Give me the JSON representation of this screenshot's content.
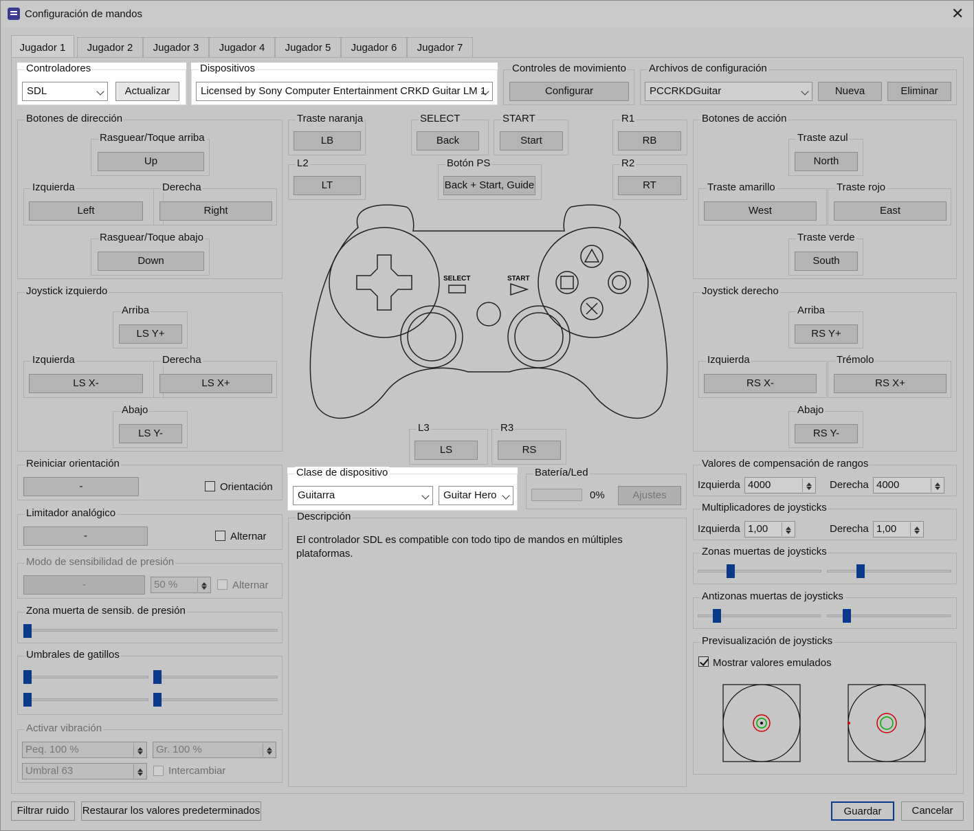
{
  "window": {
    "title": "Configuración de mandos"
  },
  "tabs": [
    "Jugador 1",
    "Jugador 2",
    "Jugador 3",
    "Jugador 4",
    "Jugador 5",
    "Jugador 6",
    "Jugador 7"
  ],
  "controllers": {
    "label": "Controladores",
    "value": "SDL",
    "refresh": "Actualizar"
  },
  "devices": {
    "label": "Dispositivos",
    "value": "Licensed by Sony Computer Entertainment CRKD Guitar LM 1"
  },
  "motion": {
    "label": "Controles de movimiento",
    "button": "Configurar"
  },
  "config_files": {
    "label": "Archivos de configuración",
    "value": "PCCRKDGuitar",
    "new": "Nueva",
    "delete": "Eliminar"
  },
  "dpad": {
    "label": "Botones de dirección",
    "up_label": "Rasguear/Toque arriba",
    "up": "Up",
    "left_label": "Izquierda",
    "left": "Left",
    "right_label": "Derecha",
    "right": "Right",
    "down_label": "Rasguear/Toque abajo",
    "down": "Down"
  },
  "center_buttons": {
    "orange_label": "Traste naranja",
    "orange": "LB",
    "select_label": "SELECT",
    "select": "Back",
    "start_label": "START",
    "start": "Start",
    "r1_label": "R1",
    "r1": "RB",
    "l2_label": "L2",
    "l2": "LT",
    "ps_label": "Botón PS",
    "ps": "Back + Start, Guide",
    "r2_label": "R2",
    "r2": "RT",
    "l3_label": "L3",
    "l3": "LS",
    "r3_label": "R3",
    "r3": "RS",
    "pad_select": "SELECT",
    "pad_start": "START"
  },
  "action": {
    "label": "Botones de acción",
    "blue_label": "Traste azul",
    "blue": "North",
    "yellow_label": "Traste amarillo",
    "yellow": "West",
    "red_label": "Traste rojo",
    "red": "East",
    "green_label": "Traste verde",
    "green": "South"
  },
  "left_stick": {
    "label": "Joystick izquierdo",
    "up_label": "Arriba",
    "up": "LS Y+",
    "left_label": "Izquierda",
    "left": "LS X-",
    "right_label": "Derecha",
    "right": "LS X+",
    "down_label": "Abajo",
    "down": "LS Y-"
  },
  "right_stick": {
    "label": "Joystick derecho",
    "up_label": "Arriba",
    "up": "RS Y+",
    "left_label": "Izquierda",
    "left": "RS X-",
    "right_label": "Trémolo",
    "right": "RS X+",
    "down_label": "Abajo",
    "down": "RS Y-"
  },
  "reset_orientation": {
    "label": "Reiniciar orientación",
    "button": "-",
    "check": "Orientación"
  },
  "analog_limiter": {
    "label": "Limitador analógico",
    "button": "-",
    "check": "Alternar"
  },
  "pressure_mode": {
    "label": "Modo de sensibilidad de presión",
    "button": "-",
    "value": "50 %",
    "check": "Alternar"
  },
  "pressure_deadzone": {
    "label": "Zona muerta de sensib. de presión"
  },
  "trigger_thresholds": {
    "label": "Umbrales de gatillos"
  },
  "vibration": {
    "label": "Activar vibración",
    "small": "Peq. 100 %",
    "large": "Gr. 100 %",
    "threshold": "Umbral 63",
    "swap": "Intercambiar"
  },
  "device_class": {
    "label": "Clase de dispositivo",
    "value": "Guitarra",
    "type": "Guitar Hero"
  },
  "battery": {
    "label": "Batería/Led",
    "percent": "0%",
    "settings": "Ajustes"
  },
  "description": {
    "label": "Descripción",
    "text": "El controlador SDL es compatible con todo tipo de mandos en múltiples plataformas."
  },
  "range_comp": {
    "label": "Valores de compensación de rangos",
    "left_label": "Izquierda",
    "left": "4000",
    "right_label": "Derecha",
    "right": "4000"
  },
  "multipliers": {
    "label": "Multiplicadores de joysticks",
    "left_label": "Izquierda",
    "left": "1,00",
    "right_label": "Derecha",
    "right": "1,00"
  },
  "deadzones": {
    "label": "Zonas muertas de joysticks"
  },
  "antideadzones": {
    "label": "Antizonas muertas de joysticks"
  },
  "preview": {
    "label": "Previsualización de joysticks",
    "check": "Mostrar valores emulados"
  },
  "footer": {
    "filter": "Filtrar ruido",
    "restore": "Restaurar los valores predeterminados",
    "save": "Guardar",
    "cancel": "Cancelar"
  }
}
